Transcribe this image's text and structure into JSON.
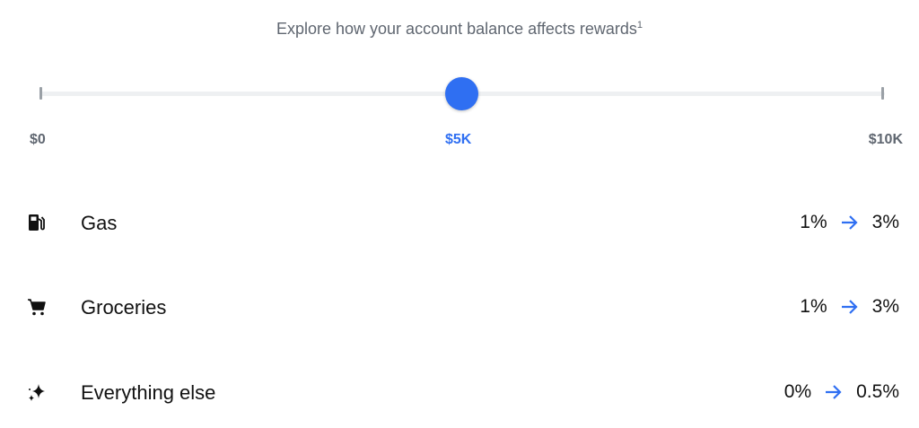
{
  "header": {
    "text": "Explore how your account balance affects rewards",
    "footnote": "1"
  },
  "slider": {
    "min_label": "$0",
    "current_label": "$5K",
    "max_label": "$10K",
    "value_fraction": 0.5,
    "accent_color": "#2f6ff2"
  },
  "rewards": [
    {
      "icon": "gas-pump-icon",
      "label": "Gas",
      "from": "1%",
      "to": "3%"
    },
    {
      "icon": "shopping-cart-icon",
      "label": "Groceries",
      "from": "1%",
      "to": "3%"
    },
    {
      "icon": "sparkles-icon",
      "label": "Everything else",
      "from": "0%",
      "to": "0.5%"
    }
  ]
}
